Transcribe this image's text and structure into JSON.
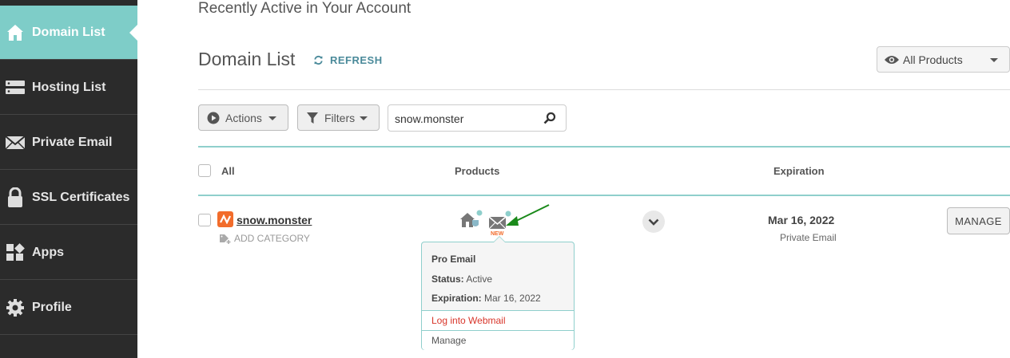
{
  "sidebar": {
    "items": [
      {
        "label": "Domain List",
        "icon": "home-icon",
        "active": true
      },
      {
        "label": "Hosting List",
        "icon": "server-icon"
      },
      {
        "label": "Private Email",
        "icon": "envelope-icon"
      },
      {
        "label": "SSL Certificates",
        "icon": "lock-icon"
      },
      {
        "label": "Apps",
        "icon": "apps-grid-icon"
      },
      {
        "label": "Profile",
        "icon": "gear-icon"
      }
    ]
  },
  "header": {
    "recent_title": "Recently Active in Your Account",
    "page_title": "Domain List",
    "refresh_label": "REFRESH",
    "products_filter": "All Products"
  },
  "toolbar": {
    "actions_label": "Actions",
    "filters_label": "Filters",
    "search_value": "snow.monster"
  },
  "table": {
    "headers": {
      "all": "All",
      "products": "Products",
      "expiration": "Expiration"
    },
    "rows": [
      {
        "domain": "snow.monster",
        "add_category": "ADD CATEGORY",
        "new_badge": "NEW",
        "expiration_date": "Mar 16, 2022",
        "expiration_sub": "Private Email",
        "manage_label": "MANAGE"
      }
    ]
  },
  "popup": {
    "title": "Pro Email",
    "status_label": "Status:",
    "status_value": "Active",
    "expiration_label": "Expiration:",
    "expiration_value": "Mar 16, 2022",
    "webmail_link": "Log into Webmail",
    "manage_link": "Manage"
  },
  "colors": {
    "sidebar_bg": "#2b2b2b",
    "sidebar_active": "#7ecdc8",
    "accent_teal": "#8fcfcc",
    "brand_orange": "#f26c2b",
    "link_red": "#d8352a",
    "annotation_green": "#1a8a1a"
  }
}
